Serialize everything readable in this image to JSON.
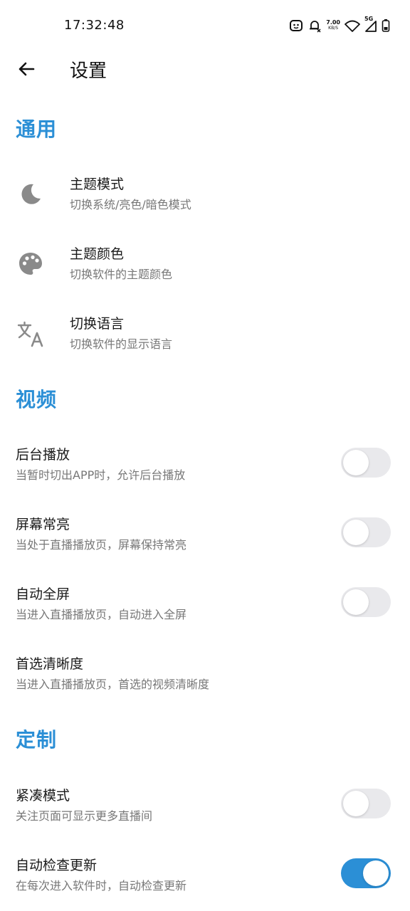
{
  "status_bar": {
    "time": "17:32:48",
    "net_speed_value": "7.00",
    "net_speed_unit": "KB/S",
    "network_type": "5G"
  },
  "app_bar": {
    "title": "设置"
  },
  "sections": {
    "general": {
      "header": "通用",
      "theme_mode": {
        "title": "主题模式",
        "subtitle": "切换系统/亮色/暗色模式"
      },
      "theme_color": {
        "title": "主题颜色",
        "subtitle": "切换软件的主题颜色"
      },
      "language": {
        "title": "切换语言",
        "subtitle": "切换软件的显示语言"
      }
    },
    "video": {
      "header": "视频",
      "background_play": {
        "title": "后台播放",
        "subtitle": "当暂时切出APP时，允许后台播放",
        "enabled": false
      },
      "screen_on": {
        "title": "屏幕常亮",
        "subtitle": "当处于直播播放页，屏幕保持常亮",
        "enabled": false
      },
      "auto_fullscreen": {
        "title": "自动全屏",
        "subtitle": "当进入直播播放页，自动进入全屏",
        "enabled": false
      },
      "preferred_quality": {
        "title": "首选清晰度",
        "subtitle": "当进入直播播放页，首选的视频清晰度"
      }
    },
    "custom": {
      "header": "定制",
      "compact_mode": {
        "title": "紧凑模式",
        "subtitle": "关注页面可显示更多直播间",
        "enabled": false
      },
      "auto_update_check": {
        "title": "自动检查更新",
        "subtitle": "在每次进入软件时，自动检查更新",
        "enabled": true
      }
    }
  },
  "colors": {
    "accent": "#2b8fd6",
    "switch_off_track": "#e9e9ec",
    "icon_gray": "#8a8a8a"
  },
  "icons": {
    "back": "arrow-left-icon",
    "theme_mode": "moon-icon",
    "theme_color": "palette-icon",
    "language": "translate-icon"
  }
}
